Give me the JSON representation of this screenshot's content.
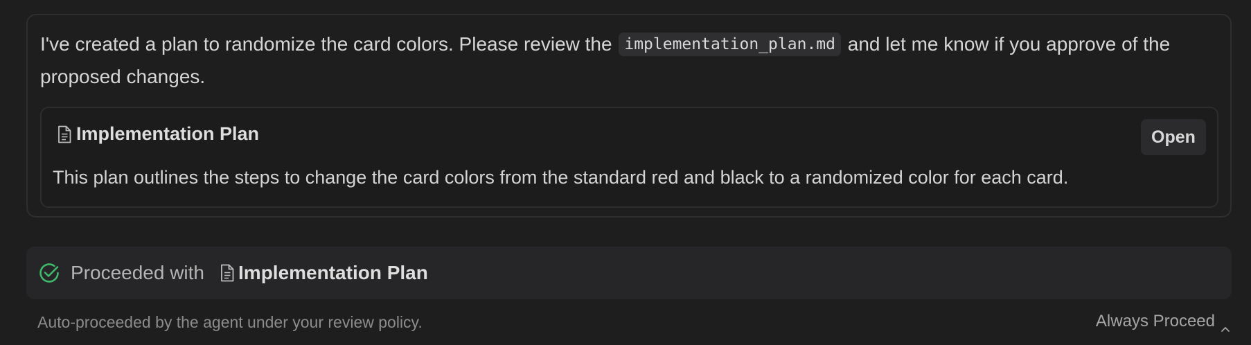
{
  "message": {
    "text_before_code": "I've created a plan to randomize the card colors. Please review the ",
    "code": "implementation_plan.md",
    "text_after_code": " and let me know if you approve of the proposed changes."
  },
  "plan_card": {
    "icon": "document-icon",
    "title": "Implementation Plan",
    "open_label": "Open",
    "description": "This plan outlines the steps to change the card colors from the standard red and black to a randomized color for each card."
  },
  "proceed": {
    "icon": "check-circle-icon",
    "label": "Proceeded with",
    "doc_icon": "document-icon",
    "doc_title": "Implementation Plan"
  },
  "footer": {
    "note": "Auto-proceeded by the agent under your review policy.",
    "policy_label": "Always Proceed",
    "policy_icon": "chevron-up-icon"
  },
  "colors": {
    "background": "#1e1e1f",
    "success_green": "#3fb96b",
    "code_chip": "#2f2f31"
  }
}
